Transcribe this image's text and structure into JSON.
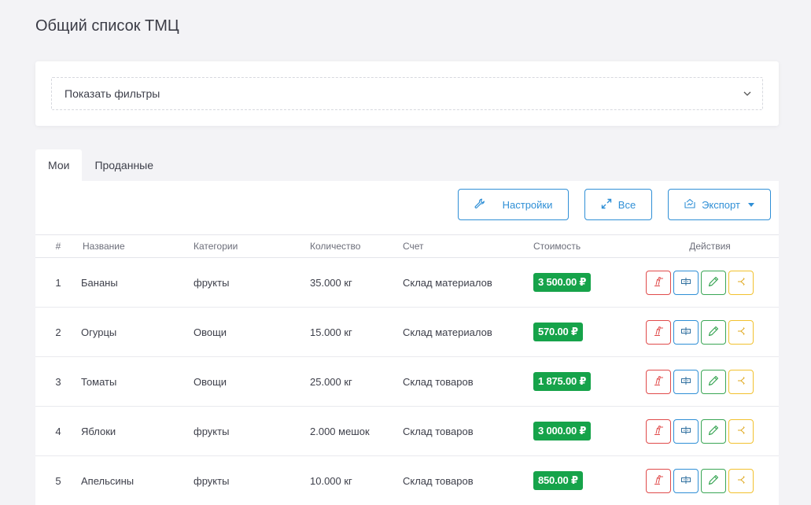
{
  "page": {
    "title": "Общий список ТМЦ"
  },
  "filters": {
    "toggle_label": "Показать фильтры"
  },
  "tabs": [
    {
      "label": "Мои",
      "active": true
    },
    {
      "label": "Проданные",
      "active": false
    }
  ],
  "toolbar": {
    "settings_label": "Настройки",
    "all_label": "Все",
    "export_label": "Экспорт"
  },
  "table": {
    "headers": {
      "num": "#",
      "name": "Название",
      "category": "Категории",
      "quantity": "Количество",
      "account": "Счет",
      "cost": "Стоимость",
      "actions": "Действия"
    },
    "rows": [
      {
        "num": "1",
        "name": "Бананы",
        "category": "фрукты",
        "quantity": "35.000 кг",
        "account": "Склад материалов",
        "cost": "3 500.00 ₽"
      },
      {
        "num": "2",
        "name": "Огурцы",
        "category": "Овощи",
        "quantity": "15.000 кг",
        "account": "Склад материалов",
        "cost": "570.00 ₽"
      },
      {
        "num": "3",
        "name": "Томаты",
        "category": "Овощи",
        "quantity": "25.000 кг",
        "account": "Склад товаров",
        "cost": "1 875.00 ₽"
      },
      {
        "num": "4",
        "name": "Яблоки",
        "category": "фрукты",
        "quantity": "2.000 мешок",
        "account": "Склад товаров",
        "cost": "3 000.00 ₽"
      },
      {
        "num": "5",
        "name": "Апельсины",
        "category": "фрукты",
        "quantity": "10.000 кг",
        "account": "Склад товаров",
        "cost": "850.00 ₽"
      }
    ],
    "row_action_icons": [
      "writeoff-icon",
      "sell-icon",
      "edit-icon",
      "transfer-icon"
    ]
  },
  "colors": {
    "accent": "#2f8fd6",
    "price_badge": "#16a34a",
    "action_red": "#e04b4b",
    "action_blue": "#2f8fd6",
    "action_green": "#3aa655",
    "action_yellow": "#f2c12e"
  }
}
